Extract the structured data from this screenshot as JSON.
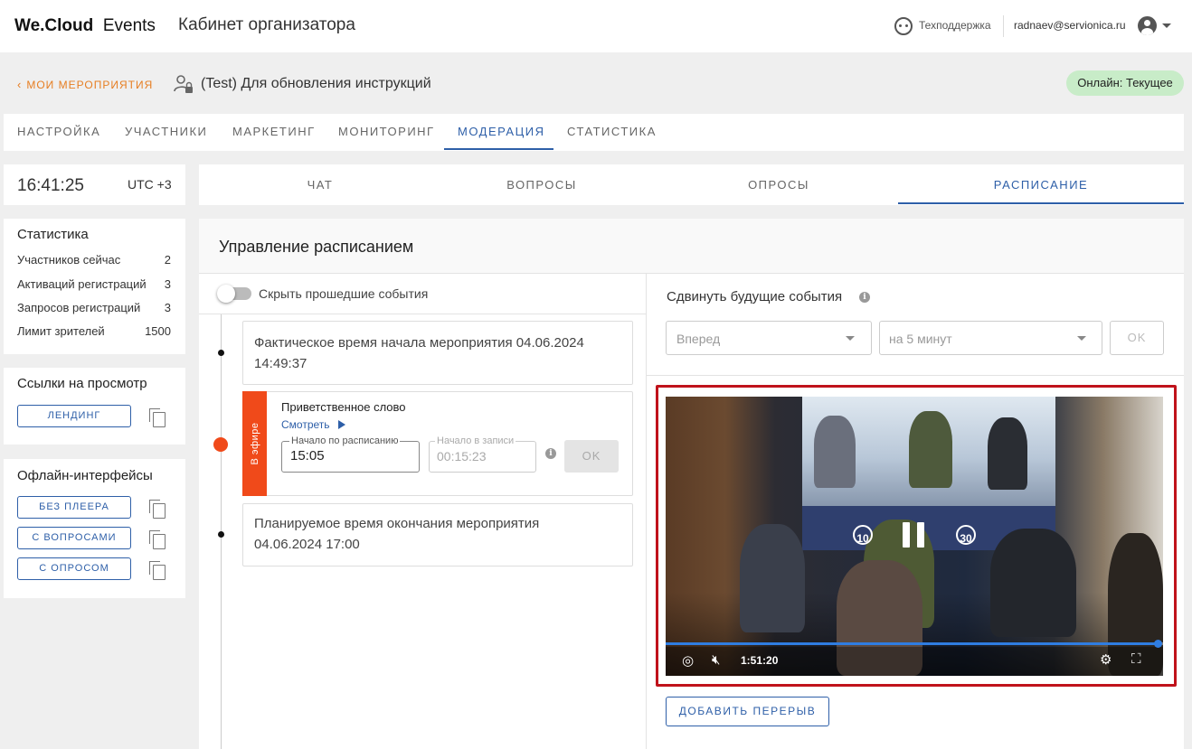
{
  "header": {
    "brand_bold": "We.Cloud",
    "brand_light": "Events",
    "cabinet_title": "Кабинет организатора",
    "support_label": "Техподдержка",
    "user_email": "radnaev@servionica.ru"
  },
  "breadcrumb": {
    "back_label": "МОИ МЕРОПРИЯТИЯ",
    "event_title": "(Test) Для обновления инструкций",
    "status_badge": "Онлайн: Текущее"
  },
  "main_tabs": [
    {
      "label": "НАСТРОЙКА",
      "active": false
    },
    {
      "label": "УЧАСТНИКИ",
      "active": false
    },
    {
      "label": "МАРКЕТИНГ",
      "active": false
    },
    {
      "label": "МОНИТОРИНГ",
      "active": false
    },
    {
      "label": "МОДЕРАЦИЯ",
      "active": true
    },
    {
      "label": "СТАТИСТИКА",
      "active": false
    }
  ],
  "clock": {
    "time": "16:41:25",
    "timezone": "UTC +3"
  },
  "stats": {
    "title": "Статистика",
    "rows": [
      {
        "label": "Участников сейчас",
        "value": "2"
      },
      {
        "label": "Активаций регистраций",
        "value": "3"
      },
      {
        "label": "Запросов регистраций",
        "value": "3"
      },
      {
        "label": "Лимит зрителей",
        "value": "1500"
      }
    ]
  },
  "view_links": {
    "title": "Ссылки на просмотр",
    "buttons": [
      "ЛЕНДИНГ"
    ]
  },
  "offline": {
    "title": "Офлайн-интерфейсы",
    "buttons": [
      "БЕЗ ПЛЕЕРА",
      "С ВОПРОСАМИ",
      "С ОПРОСОМ"
    ]
  },
  "sub_tabs": [
    {
      "label": "ЧАТ",
      "active": false
    },
    {
      "label": "ВОПРОСЫ",
      "active": false
    },
    {
      "label": "ОПРОСЫ",
      "active": false
    },
    {
      "label": "РАСПИСАНИЕ",
      "active": true
    }
  ],
  "schedule": {
    "title": "Управление расписанием",
    "hide_past_label": "Скрыть прошедшие события",
    "hide_past_enabled": false,
    "start_card": {
      "line1": "Фактическое время начала мероприятия 04.06.2024",
      "line2": "14:49:37"
    },
    "session": {
      "live_label": "В эфире",
      "title": "Приветственное слово",
      "watch_label": "Смотреть",
      "scheduled_label": "Начало по расписанию",
      "scheduled_value": "15:05",
      "recorded_label": "Начало в записи",
      "recorded_value": "00:15:23",
      "ok_label": "OK"
    },
    "end_card": {
      "line1": "Планируемое время окончания мероприятия",
      "line2": "04.06.2024 17:00"
    }
  },
  "shift": {
    "label": "Сдвинуть будущие события",
    "direction": "Вперед",
    "amount": "на 5 минут",
    "ok_label": "OK"
  },
  "player": {
    "time": "1:51:20",
    "progress": 0.993,
    "skip_back": "10",
    "skip_forward": "30"
  },
  "add_break_label": "ДОБАВИТЬ ПЕРЕРЫВ",
  "colors": {
    "accent": "#2e5fa8",
    "live": "#f04a1a",
    "back_link": "#e67e22",
    "highlight_frame": "#c0121b",
    "online_badge": "#c8ecc8"
  }
}
